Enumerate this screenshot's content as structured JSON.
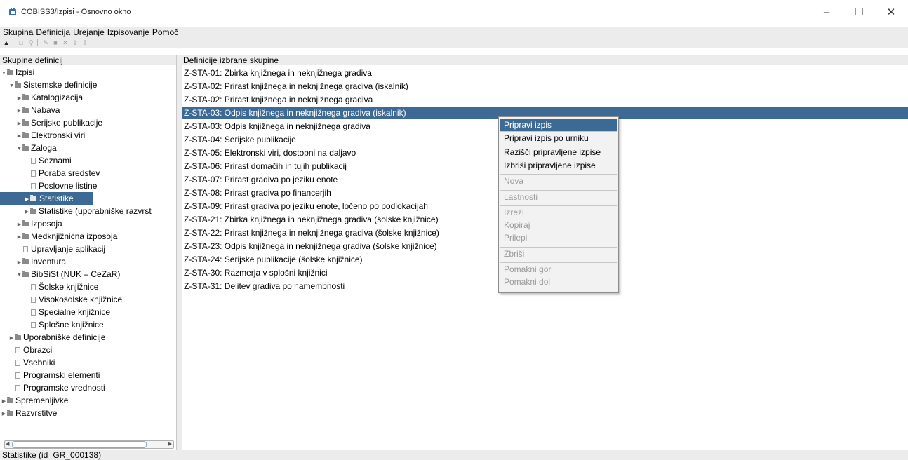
{
  "window": {
    "title": "COBISS3/Izpisi - Osnovno okno",
    "minimize": "–",
    "maximize": "☐",
    "close": "✕"
  },
  "menubar": [
    "Skupina",
    "Definicija",
    "Urejanje",
    "Izpisovanje",
    "Pomoč"
  ],
  "toolbar_icons": [
    "run-icon",
    "new-icon",
    "find-icon",
    "edit-icon",
    "save-icon",
    "delete-icon",
    "move-up-icon",
    "move-down-icon"
  ],
  "left_panel": {
    "header": "Skupine definicij",
    "tree": [
      {
        "label": "Izpisi",
        "type": "folder",
        "expanded": true
      },
      {
        "label": "Sistemske definicije",
        "type": "folder",
        "expanded": true
      },
      {
        "label": "Katalogizacija",
        "type": "folder",
        "expanded": false
      },
      {
        "label": "Nabava",
        "type": "folder",
        "expanded": false
      },
      {
        "label": "Serijske publikacije",
        "type": "folder",
        "expanded": false
      },
      {
        "label": "Elektronski viri",
        "type": "folder",
        "expanded": false
      },
      {
        "label": "Zaloga",
        "type": "folder",
        "expanded": true
      },
      {
        "label": "Seznami",
        "type": "doc"
      },
      {
        "label": "Poraba sredstev",
        "type": "doc"
      },
      {
        "label": "Poslovne listine",
        "type": "doc"
      },
      {
        "label": "Statistike",
        "type": "folder",
        "expanded": false,
        "selected": true
      },
      {
        "label": "Statistike (uporabniške razvrst",
        "type": "folder",
        "expanded": false
      },
      {
        "label": "Izposoja",
        "type": "folder",
        "expanded": false
      },
      {
        "label": "Medknjižnična izposoja",
        "type": "folder",
        "expanded": false
      },
      {
        "label": "Upravljanje aplikacij",
        "type": "doc"
      },
      {
        "label": "Inventura",
        "type": "folder",
        "expanded": false
      },
      {
        "label": "BibSiSt (NUK – CeZaR)",
        "type": "folder",
        "expanded": true
      },
      {
        "label": "Šolske knjižnice",
        "type": "doc"
      },
      {
        "label": "Visokošolske knjižnice",
        "type": "doc"
      },
      {
        "label": "Specialne knjižnice",
        "type": "doc"
      },
      {
        "label": "Splošne knjižnice",
        "type": "doc"
      },
      {
        "label": "Uporabniške definicije",
        "type": "folder",
        "expanded": false
      },
      {
        "label": "Obrazci",
        "type": "doc"
      },
      {
        "label": "Vsebniki",
        "type": "doc"
      },
      {
        "label": "Programski elementi",
        "type": "doc"
      },
      {
        "label": "Programske vrednosti",
        "type": "doc"
      },
      {
        "label": "Spremenljivke",
        "type": "folder",
        "expanded": false
      },
      {
        "label": "Razvrstitve",
        "type": "folder",
        "expanded": false
      }
    ]
  },
  "right_panel": {
    "header": "Definicije izbrane skupine",
    "items": [
      "Z-STA-01: Zbirka knjižnega in neknjižnega gradiva",
      "Z-STA-02: Prirast knjižnega in neknjižnega gradiva (iskalnik)",
      "Z-STA-02: Prirast knjižnega in neknjižnega gradiva",
      "Z-STA-03: Odpis knjižnega in neknjižnega gradiva (iskalnik)",
      "Z-STA-03: Odpis knjižnega in neknjižnega gradiva",
      "Z-STA-04: Serijske publikacije",
      "Z-STA-05: Elektronski viri, dostopni na daljavo",
      "Z-STA-06: Prirast domačih in tujih publikacij",
      "Z-STA-07: Prirast gradiva po jeziku enote",
      "Z-STA-08: Prirast gradiva po financerjih",
      "Z-STA-09: Prirast gradiva po jeziku enote, ločeno po podlokacijah",
      "Z-STA-21: Zbirka knjižnega in neknjižnega gradiva (šolske knjižnice)",
      "Z-STA-22: Prirast knjižnega in neknjižnega gradiva (šolske knjižnice)",
      "Z-STA-23: Odpis knjižnega in neknjižnega gradiva (šolske knjižnice)",
      "Z-STA-24: Serijske publikacije (šolske knjižnice)",
      "Z-STA-30: Razmerja v splošni knjižnici",
      "Z-STA-31: Delitev gradiva po namembnosti"
    ],
    "selected_index": 3
  },
  "context_menu": {
    "items": [
      {
        "label": "Pripravi izpis",
        "enabled": true,
        "highlighted": true
      },
      {
        "label": "Pripravi izpis po urniku",
        "enabled": true
      },
      {
        "label": "Razišči pripravljene izpise",
        "enabled": true
      },
      {
        "label": "Izbriši pripravljene izpise",
        "enabled": true
      },
      {
        "label": "Nova",
        "enabled": false
      },
      {
        "label": "Lastnosti",
        "enabled": false
      },
      {
        "label": "Izreži",
        "enabled": false
      },
      {
        "label": "Kopiraj",
        "enabled": false
      },
      {
        "label": "Prilepi",
        "enabled": false
      },
      {
        "label": "Zbriši",
        "enabled": false
      },
      {
        "label": "Pomakni gor",
        "enabled": false
      },
      {
        "label": "Pomakni dol",
        "enabled": false
      }
    ]
  },
  "statusbar": {
    "text": "Statistike (id=GR_000138)"
  },
  "colors": {
    "selection": "#3d6a94",
    "panel_bg": "#ececec",
    "disabled_text": "#9a9a9a"
  }
}
